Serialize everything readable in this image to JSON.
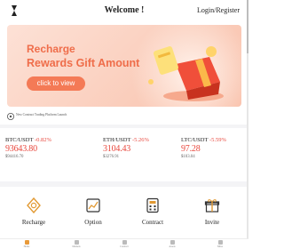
{
  "header": {
    "title": "Welcome !",
    "login_label": "Login/Register"
  },
  "banner": {
    "line1": "Recharge",
    "line2": "Rewards Gift Amount",
    "button_label": "click to view"
  },
  "notice": {
    "text": "New Contract Trading Platform Launch"
  },
  "tickers": [
    {
      "pair": "BTC/USDT",
      "change": "-0.82%",
      "price": "93643.80",
      "volume": "$94416.70"
    },
    {
      "pair": "ETH/USDT",
      "change": "-5.26%",
      "price": "3104.43",
      "volume": "$3276.91"
    },
    {
      "pair": "LTC/USDT",
      "change": "-5.59%",
      "price": "97.28",
      "volume": "$103.04"
    }
  ],
  "quick_actions": [
    {
      "label": "Recharge",
      "icon": "shield-coin-icon"
    },
    {
      "label": "Option",
      "icon": "chart-icon"
    },
    {
      "label": "Contract",
      "icon": "calculator-icon"
    },
    {
      "label": "Invite",
      "icon": "gift-icon"
    }
  ],
  "tabbar": {
    "items": [
      {
        "label": "Home",
        "icon": "home-icon"
      },
      {
        "label": "Markets",
        "icon": "markets-icon"
      },
      {
        "label": "Contract",
        "icon": "contract-icon"
      },
      {
        "label": "Assets",
        "icon": "assets-icon"
      },
      {
        "label": "Mine",
        "icon": "user-icon"
      }
    ]
  },
  "colors": {
    "accent": "#f47a56",
    "banner_text": "#ef6d4a",
    "negative": "#e8473d",
    "active_tab": "#e89a3a"
  }
}
